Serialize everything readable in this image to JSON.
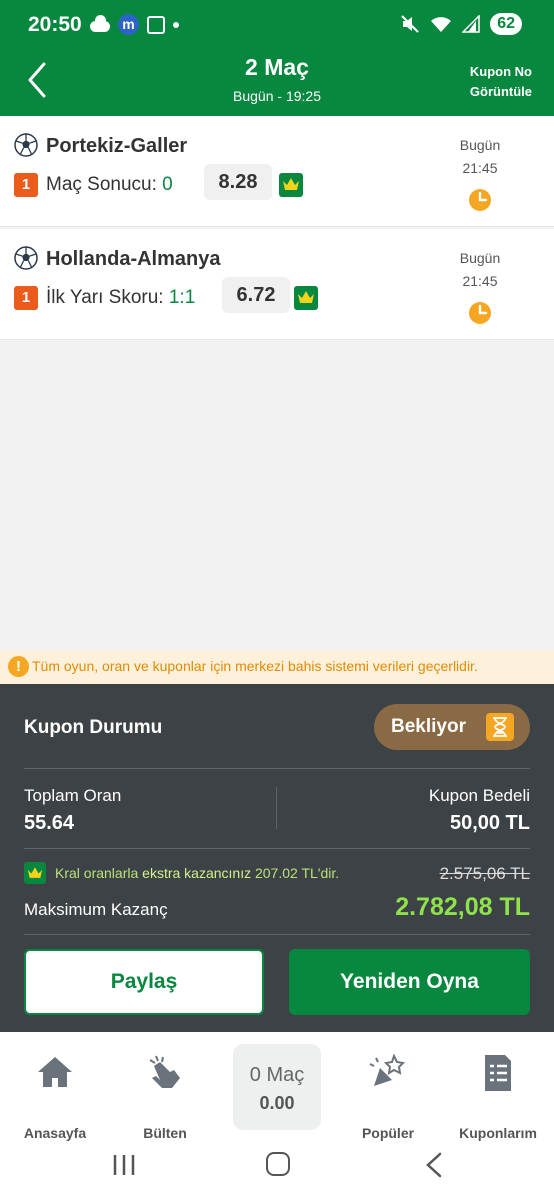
{
  "status_bar": {
    "time": "20:50",
    "app_badge": "m",
    "battery": "62"
  },
  "header": {
    "title": "2 Maç",
    "subtitle": "Bugün - 19:25",
    "kupon_no_line1": "Kupon No",
    "kupon_no_line2": "Görüntüle"
  },
  "matches": [
    {
      "name": "Portekiz-Galler",
      "index": "1",
      "bet_label": "Maç Sonucu: ",
      "pick": "0",
      "odd": "8.28",
      "day": "Bugün",
      "time": "21:45"
    },
    {
      "name": "Hollanda-Almanya",
      "index": "1",
      "bet_label": "İlk Yarı Skoru: ",
      "pick": "1:1",
      "odd": "6.72",
      "day": "Bugün",
      "time": "21:45"
    }
  ],
  "warning": {
    "icon": "!",
    "text": "Tüm oyun, oran ve kuponlar için merkezi bahis sistemi verileri geçerlidir."
  },
  "summary": {
    "title": "Kupon Durumu",
    "status": "Bekliyor",
    "total_odds_label": "Toplam Oran",
    "total_odds": "55.64",
    "stake_label": "Kupon Bedeli",
    "stake": "50,00 TL",
    "kral_pre": "Kral oranlarla ",
    "kral_bold": "ekstra kazancınız",
    "kral_post": " 207.02 TL'dir.",
    "old_max_win": "2.575,06 TL",
    "max_win_label": "Maksimum Kazanç",
    "max_win": "2.782,08 TL",
    "share_label": "Paylaş",
    "replay_label": "Yeniden Oyna"
  },
  "bottom_nav": {
    "home": "Anasayfa",
    "bulletin": "Bülten",
    "center_line1": "0 Maç",
    "center_line2": "0.00",
    "popular": "Popüler",
    "coupons": "Kuponlarım"
  },
  "colors": {
    "brand_green": "#08873f",
    "panel_dark": "#3c4245",
    "badge_orange": "#ea5b1c",
    "status_brown": "#8a6a44",
    "accent_yellow": "#f5a623",
    "win_green": "#8ee34b"
  }
}
